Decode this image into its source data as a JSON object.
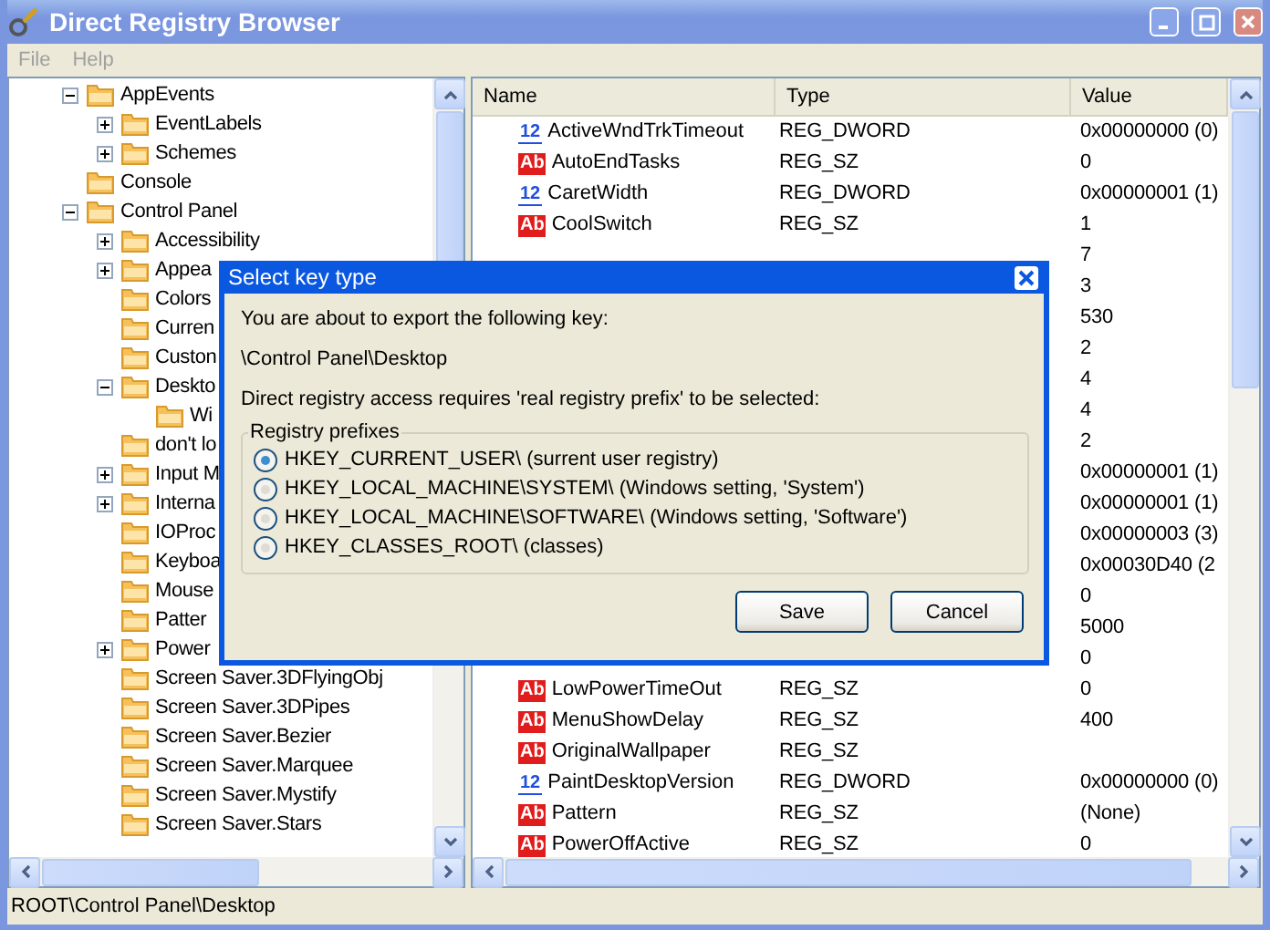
{
  "window": {
    "title": "Direct Registry Browser"
  },
  "menu": [
    {
      "label": "File",
      "disabled": true
    },
    {
      "label": "Help",
      "disabled": true
    }
  ],
  "tree": [
    {
      "label": "AppEvents",
      "expanded": true,
      "children": [
        {
          "label": "EventLabels",
          "expanded": false
        },
        {
          "label": "Schemes",
          "expanded": false
        }
      ]
    },
    {
      "label": "Console"
    },
    {
      "label": "Control Panel",
      "expanded": true,
      "children": [
        {
          "label": "Accessibility",
          "expanded": false
        },
        {
          "label": "Appea",
          "expanded": false
        },
        {
          "label": "Colors"
        },
        {
          "label": "Curren"
        },
        {
          "label": "Custon"
        },
        {
          "label": "Deskto",
          "expanded": true,
          "children": [
            {
              "label": "Wi"
            }
          ]
        },
        {
          "label": "don't lo"
        },
        {
          "label": "Input M",
          "expanded": false
        },
        {
          "label": "Interna",
          "expanded": false
        },
        {
          "label": "IOProc"
        },
        {
          "label": "Keyboa"
        },
        {
          "label": "Mouse"
        },
        {
          "label": "Patter"
        },
        {
          "label": "Power",
          "expanded": false
        },
        {
          "label": "Screen Saver.3DFlyingObj"
        },
        {
          "label": "Screen Saver.3DPipes"
        },
        {
          "label": "Screen Saver.Bezier"
        },
        {
          "label": "Screen Saver.Marquee"
        },
        {
          "label": "Screen Saver.Mystify"
        },
        {
          "label": "Screen Saver.Stars"
        }
      ]
    }
  ],
  "table": {
    "columns": [
      "Name",
      "Type",
      "Value"
    ],
    "rows": [
      {
        "kind": "dword",
        "badge": "12",
        "name": "ActiveWndTrkTimeout",
        "type": "REG_DWORD",
        "value": "0x00000000 (0)"
      },
      {
        "kind": "sz",
        "badge": "Ab",
        "name": "AutoEndTasks",
        "type": "REG_SZ",
        "value": "0"
      },
      {
        "kind": "dword",
        "badge": "12",
        "name": "CaretWidth",
        "type": "REG_DWORD",
        "value": "0x00000001 (1)"
      },
      {
        "kind": "sz",
        "badge": "Ab",
        "name": "CoolSwitch",
        "type": "REG_SZ",
        "value": "1"
      },
      {
        "value": "7"
      },
      {
        "value": "3"
      },
      {
        "value": "530"
      },
      {
        "value": "2"
      },
      {
        "value": "4"
      },
      {
        "value": "4"
      },
      {
        "value": "2"
      },
      {
        "value": "0x00000001 (1)"
      },
      {
        "value": "0x00000001 (1)"
      },
      {
        "value": "0x00000003 (3)"
      },
      {
        "value": "0x00030D40 (2"
      },
      {
        "value": "0"
      },
      {
        "value": "5000"
      },
      {
        "value": "0"
      },
      {
        "kind": "sz",
        "badge": "Ab",
        "name": "LowPowerTimeOut",
        "type": "REG_SZ",
        "value": "0"
      },
      {
        "kind": "sz",
        "badge": "Ab",
        "name": "MenuShowDelay",
        "type": "REG_SZ",
        "value": "400"
      },
      {
        "kind": "sz",
        "badge": "Ab",
        "name": "OriginalWallpaper",
        "type": "REG_SZ"
      },
      {
        "kind": "dword",
        "badge": "12",
        "name": "PaintDesktopVersion",
        "type": "REG_DWORD",
        "value": "0x00000000 (0)"
      },
      {
        "kind": "sz",
        "badge": "Ab",
        "name": "Pattern",
        "type": "REG_SZ",
        "value": "(None)"
      },
      {
        "kind": "sz",
        "badge": "Ab",
        "name": "PowerOffActive",
        "type": "REG_SZ",
        "value": "0"
      }
    ]
  },
  "status_bar": "ROOT\\Control Panel\\Desktop",
  "dialog": {
    "title": "Select key type",
    "intro": "You are about to export the following key:",
    "key_path": "\\Control Panel\\Desktop",
    "requirement": "Direct registry access requires 'real registry prefix' to be selected:",
    "group_label": "Registry prefixes",
    "options": [
      {
        "label": "HKEY_CURRENT_USER\\ (surrent user registry)",
        "selected": true
      },
      {
        "label": "HKEY_LOCAL_MACHINE\\SYSTEM\\ (Windows setting, 'System')",
        "selected": false
      },
      {
        "label": "HKEY_LOCAL_MACHINE\\SOFTWARE\\ (Windows setting, 'Software')",
        "selected": false
      },
      {
        "label": "HKEY_CLASSES_ROOT\\ (classes)",
        "selected": false
      }
    ],
    "buttons": [
      {
        "label": "Save"
      },
      {
        "label": "Cancel"
      }
    ]
  }
}
